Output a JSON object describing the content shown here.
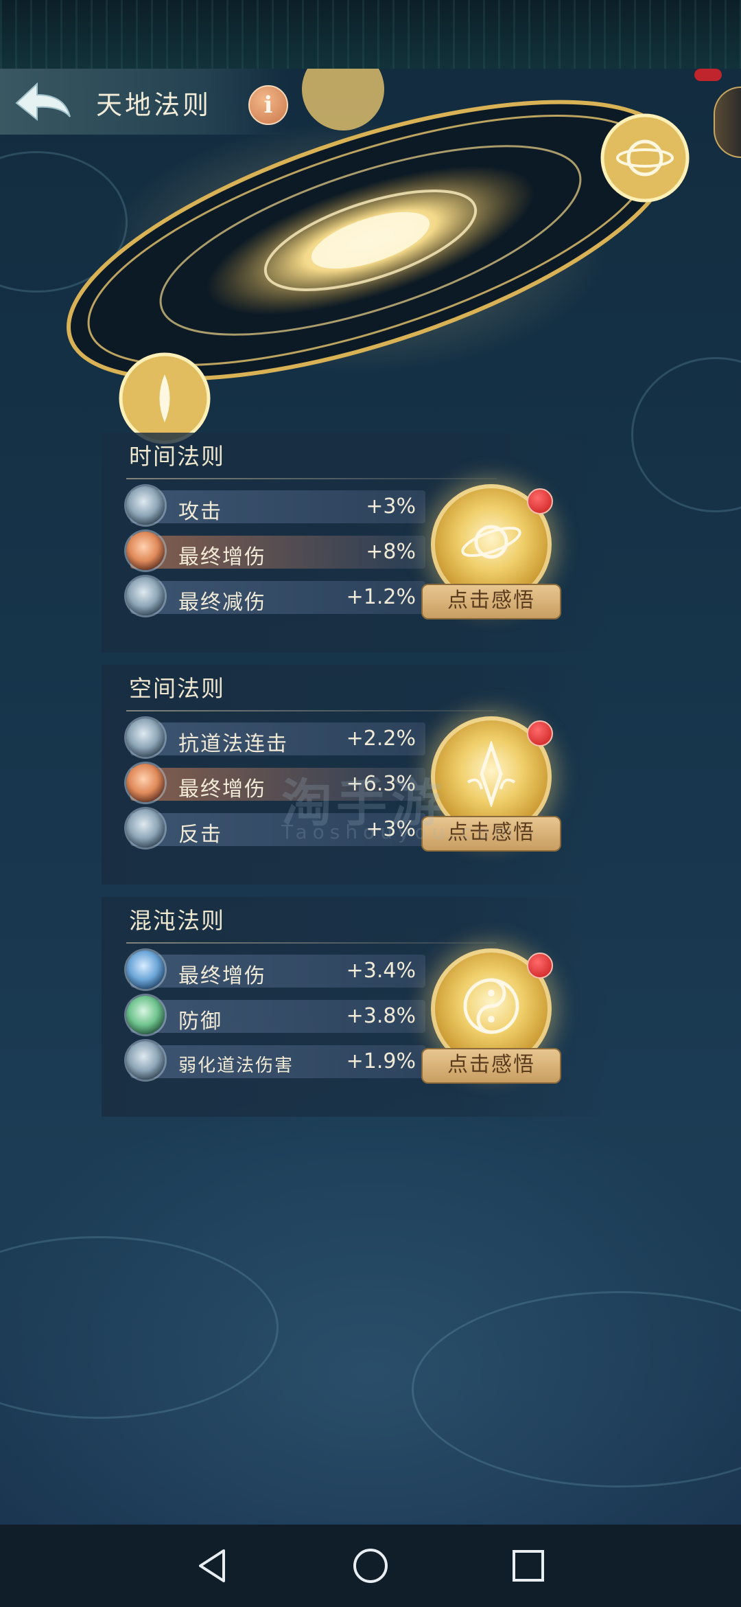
{
  "header": {
    "title": "天地法则",
    "info_label": "i"
  },
  "sections": [
    {
      "title": "时间法则",
      "rows": [
        {
          "label": "攻击",
          "value": "+3%",
          "orb": "grey"
        },
        {
          "label": "最终增伤",
          "value": "+8%",
          "orb": "orange"
        },
        {
          "label": "最终减伤",
          "value": "+1.2%",
          "orb": "grey"
        }
      ],
      "button": "点击感悟",
      "icon": "planet-icon"
    },
    {
      "title": "空间法则",
      "rows": [
        {
          "label": "抗道法连击",
          "value": "+2.2%",
          "orb": "grey"
        },
        {
          "label": "最终增伤",
          "value": "+6.3%",
          "orb": "orange"
        },
        {
          "label": "反击",
          "value": "+3%",
          "orb": "grey"
        }
      ],
      "button": "点击感悟",
      "icon": "crystal-icon"
    },
    {
      "title": "混沌法则",
      "rows": [
        {
          "label": "最终增伤",
          "value": "+3.4%",
          "orb": "blue"
        },
        {
          "label": "防御",
          "value": "+3.8%",
          "orb": "green"
        },
        {
          "label": "弱化道法伤害",
          "value": "+1.9%",
          "orb": "grey"
        }
      ],
      "button": "点击感悟",
      "icon": "yin-yang-icon"
    }
  ],
  "watermark": {
    "main": "淘手游",
    "sub": "Taoshouyou.com"
  },
  "colors": {
    "gold": "#f0cf6b",
    "panel": "#192d41",
    "alert": "#c81b1b"
  }
}
